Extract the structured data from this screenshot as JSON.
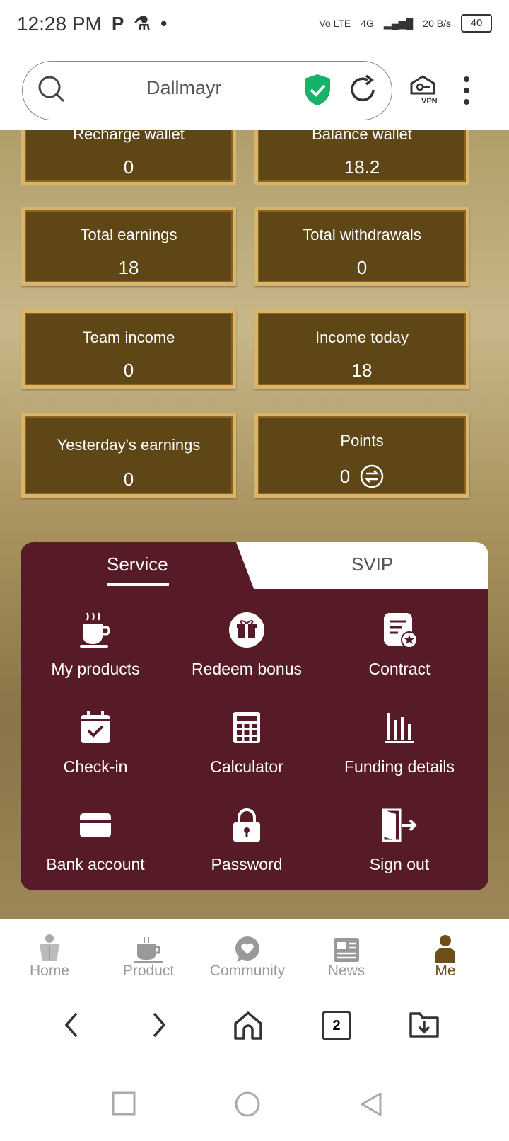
{
  "status": {
    "time": "12:28 PM",
    "network": "4G",
    "volte": "Vo LTE",
    "speed": "20 B/s",
    "battery": "40"
  },
  "browser": {
    "url_text": "Dallmayr",
    "tab_count": "2"
  },
  "cards": [
    {
      "label": "Recharge wallet",
      "value": "0"
    },
    {
      "label": "Balance wallet",
      "value": "18.2"
    },
    {
      "label": "Total earnings",
      "value": "18"
    },
    {
      "label": "Total withdrawals",
      "value": "0"
    },
    {
      "label": "Team income",
      "value": "0"
    },
    {
      "label": "Income today",
      "value": "18"
    },
    {
      "label": "Yesterday's earnings",
      "value": "0"
    },
    {
      "label": "Points",
      "value": "0"
    }
  ],
  "tabs": {
    "service": "Service",
    "svip": "SVIP"
  },
  "services": [
    {
      "label": "My products",
      "icon": "coffee-cup-icon"
    },
    {
      "label": "Redeem bonus",
      "icon": "gift-icon"
    },
    {
      "label": "Contract",
      "icon": "contract-icon"
    },
    {
      "label": "Check-in",
      "icon": "calendar-check-icon"
    },
    {
      "label": "Calculator",
      "icon": "calculator-icon"
    },
    {
      "label": "Funding details",
      "icon": "bar-chart-icon"
    },
    {
      "label": "Bank account",
      "icon": "card-icon"
    },
    {
      "label": "Password",
      "icon": "lock-icon"
    },
    {
      "label": "Sign out",
      "icon": "exit-icon"
    }
  ],
  "nav": [
    {
      "label": "Home"
    },
    {
      "label": "Product"
    },
    {
      "label": "Community"
    },
    {
      "label": "News"
    },
    {
      "label": "Me"
    }
  ],
  "colors": {
    "card_bg": "#5e4617",
    "card_border": "#d9b56c",
    "panel_bg": "#561b27",
    "active_nav": "#6e4f17",
    "shield": "#17b26a"
  }
}
